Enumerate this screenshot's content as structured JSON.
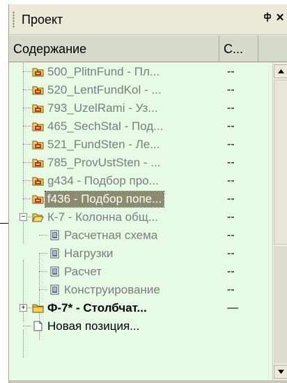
{
  "panel": {
    "title": "Проект",
    "pin_glyph": "ᵽ",
    "close_glyph": "×"
  },
  "columns": {
    "content": "Содержание",
    "second": "С..."
  },
  "tree": [
    {
      "label": "500_PlitnFund - Пл...",
      "value": "--",
      "icon": "folder-marked-icon"
    },
    {
      "label": "520_LentFundKol - ...",
      "value": "--",
      "icon": "folder-marked-icon"
    },
    {
      "label": "793_UzelRami - Уз...",
      "value": "--",
      "icon": "folder-marked-icon"
    },
    {
      "label": "465_SechStal - Под...",
      "value": "--",
      "icon": "folder-marked-icon"
    },
    {
      "label": "521_FundSten - Ле...",
      "value": "--",
      "icon": "folder-marked-icon"
    },
    {
      "label": "785_ProvUstSten - ...",
      "value": "--",
      "icon": "folder-marked-icon"
    },
    {
      "label": "g434 - Подбор про...",
      "value": "--",
      "icon": "folder-marked-icon"
    },
    {
      "label": "f436 - Подбор попе...",
      "value": "--",
      "icon": "folder-marked-icon"
    },
    {
      "label": "К-7 - Колонна общ...",
      "value": "--",
      "icon": "folder-open-icon"
    },
    {
      "label": "Расчетная схема",
      "value": "--",
      "icon": "document-icon"
    },
    {
      "label": "Нагрузки",
      "value": "--",
      "icon": "document-icon"
    },
    {
      "label": "Расчет",
      "value": "--",
      "icon": "document-icon"
    },
    {
      "label": "Конструирование",
      "value": "--",
      "icon": "document-icon"
    },
    {
      "label": "Ф-7* - Столбчат...",
      "value": "—",
      "icon": "folder-closed-icon"
    },
    {
      "label": "Новая позиция...",
      "value": "",
      "icon": "new-page-icon"
    }
  ],
  "colors": {
    "tree_background": "#e6fae6",
    "selection": "#8d8b6e",
    "icon_mark": "#b5342c",
    "folder_yellow": "#f3d04d"
  }
}
